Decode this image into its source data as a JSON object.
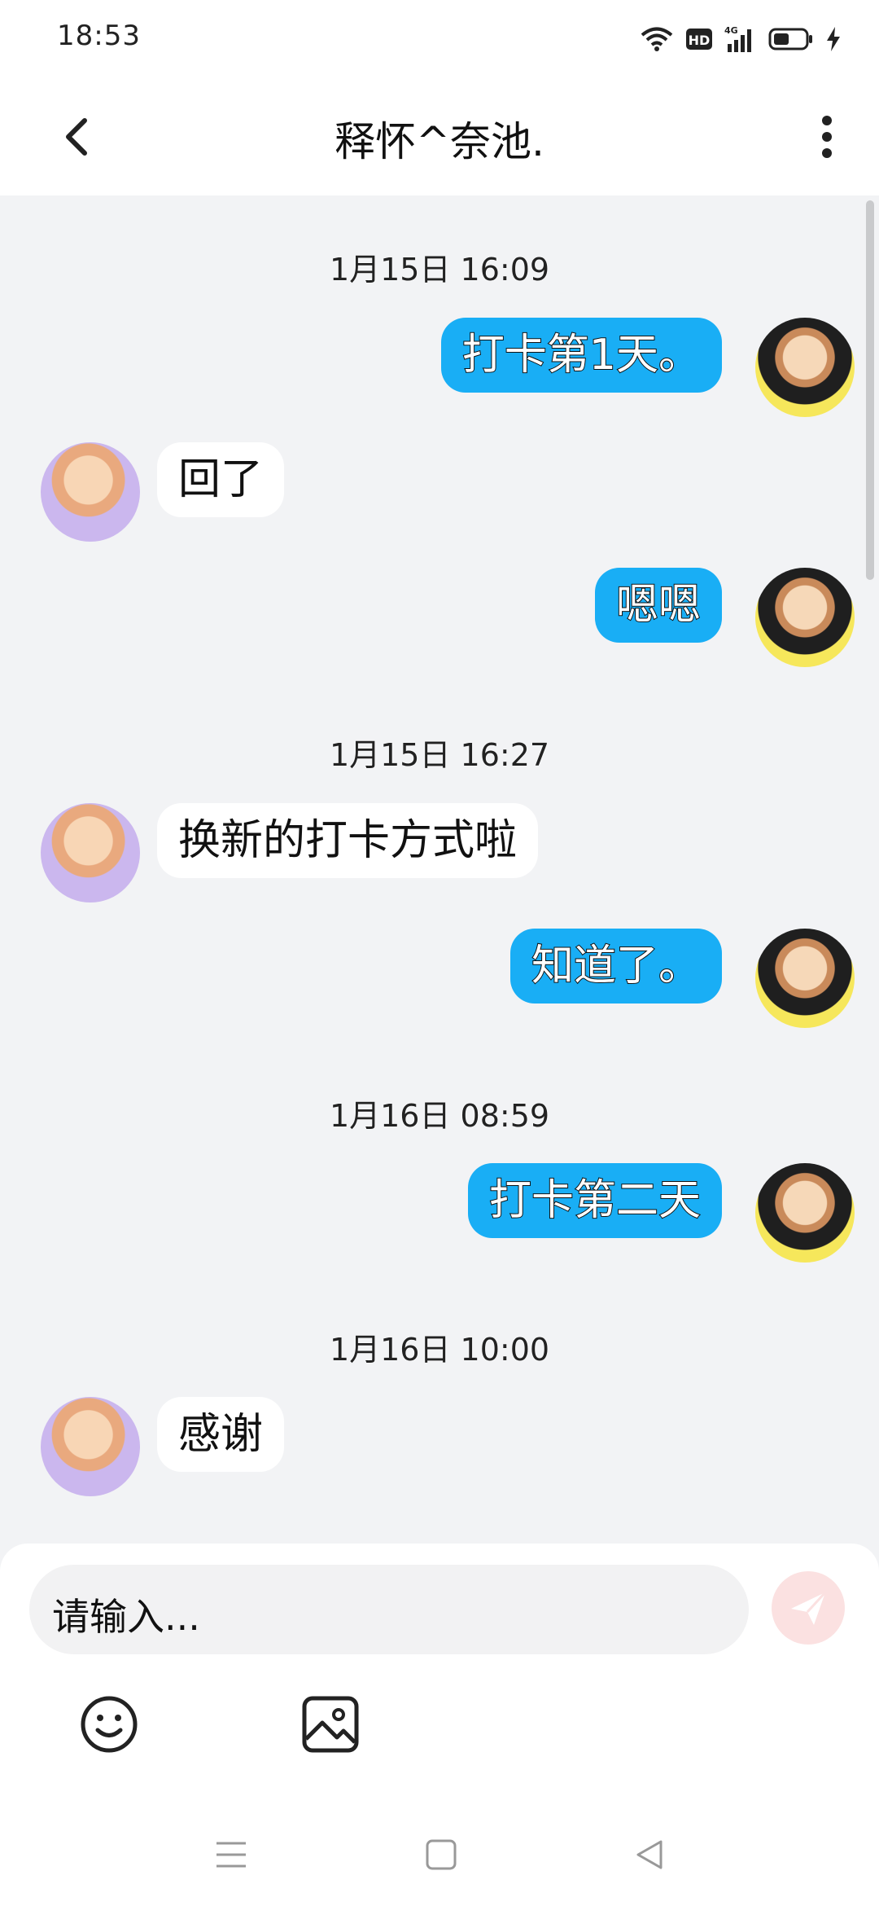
{
  "status_bar": {
    "time": "18:53",
    "network": "4G"
  },
  "header": {
    "title": "释怀^奈池."
  },
  "messages": [
    {
      "kind": "timestamp",
      "text": "1月15日 16:09"
    },
    {
      "kind": "message",
      "from": "me",
      "text": "打卡第1天。"
    },
    {
      "kind": "message",
      "from": "other",
      "text": "回了"
    },
    {
      "kind": "message",
      "from": "me",
      "text": "嗯嗯"
    },
    {
      "kind": "timestamp",
      "text": "1月15日 16:27"
    },
    {
      "kind": "message",
      "from": "other",
      "text": "换新的打卡方式啦"
    },
    {
      "kind": "message",
      "from": "me",
      "text": "知道了。"
    },
    {
      "kind": "timestamp",
      "text": "1月16日 08:59"
    },
    {
      "kind": "message",
      "from": "me",
      "text": "打卡第二天"
    },
    {
      "kind": "timestamp",
      "text": "1月16日 10:00"
    },
    {
      "kind": "message",
      "from": "other",
      "text": "感谢"
    }
  ],
  "composer": {
    "placeholder": "请输入..."
  },
  "colors": {
    "my_bubble": "#19aef5",
    "other_bubble": "#ffffff",
    "background": "#f2f3f5",
    "send_button": "#fbe1e1"
  },
  "icons": [
    "back-arrow-icon",
    "more-vertical-icon",
    "emoji-icon",
    "image-icon",
    "send-icon",
    "wifi-icon",
    "hd-icon",
    "signal-icon",
    "battery-icon",
    "charging-icon"
  ]
}
